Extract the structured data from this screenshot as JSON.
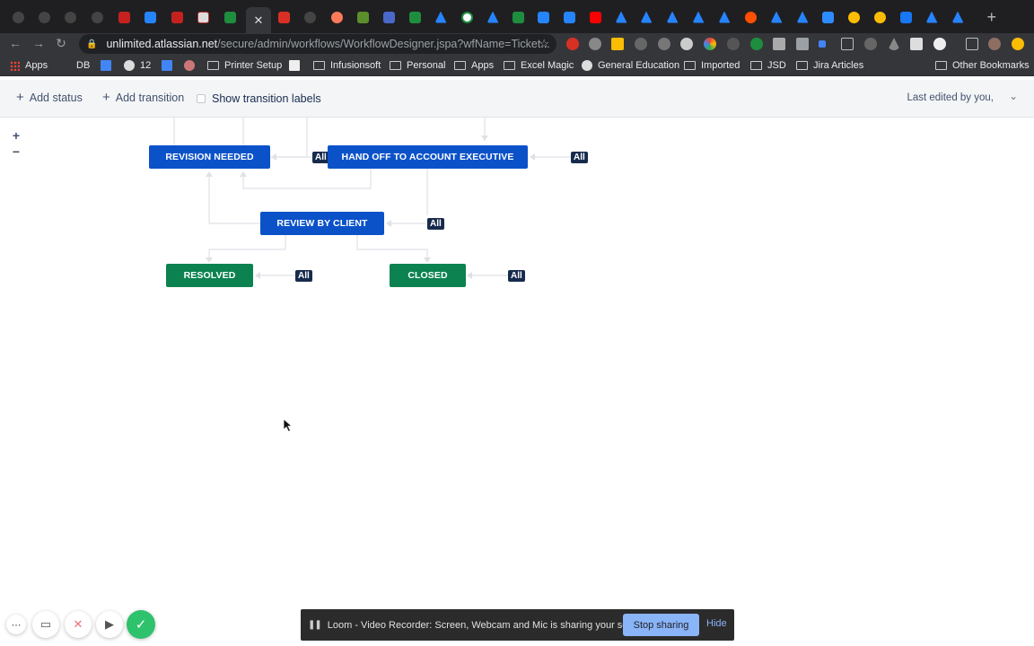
{
  "browser": {
    "url_host": "unlimited.atlassian.net",
    "url_path": "/secure/admin/workflows/WorkflowDesigner.jspa?wfName=Ticket...",
    "bookmarks": [
      {
        "label": "Apps",
        "icon": "apps-grid-icon"
      },
      {
        "label": "DB",
        "icon": "none"
      },
      {
        "label": "",
        "icon": "chart-icon"
      },
      {
        "label": "12",
        "icon": "globe-icon"
      },
      {
        "label": "",
        "icon": "bar-chart-icon"
      },
      {
        "label": "",
        "icon": "app-icon"
      },
      {
        "label": "Printer Setup",
        "icon": "folder-icon"
      },
      {
        "label": "",
        "icon": "calendar-icon"
      },
      {
        "label": "Infusionsoft",
        "icon": "folder-icon"
      },
      {
        "label": "Personal",
        "icon": "folder-icon"
      },
      {
        "label": "Apps",
        "icon": "folder-icon"
      },
      {
        "label": "Excel Magic",
        "icon": "folder-icon"
      },
      {
        "label": "General Education",
        "icon": "globe-icon"
      },
      {
        "label": "Imported",
        "icon": "folder-icon"
      },
      {
        "label": "JSD",
        "icon": "folder-icon"
      },
      {
        "label": "Jira Articles",
        "icon": "folder-icon"
      },
      {
        "label": "Other Bookmarks",
        "icon": "folder-icon"
      }
    ]
  },
  "toolbar": {
    "add_status": "Add status",
    "add_transition": "Add transition",
    "show_labels": "Show transition labels",
    "last_edited": "Last edited by you,"
  },
  "zoom": {
    "in": "+",
    "out": "−"
  },
  "workflow": {
    "statuses": {
      "revision_needed": "REVISION NEEDED",
      "hand_off": "HAND OFF TO ACCOUNT EXECUTIVE",
      "review_by_client": "REVIEW BY CLIENT",
      "resolved": "RESOLVED",
      "closed": "CLOSED"
    },
    "all_label": "All",
    "colors": {
      "in_progress": "#0b52c9",
      "done": "#0c8250",
      "all_badge": "#172b4d"
    }
  },
  "loom": {
    "message": "Loom - Video Recorder: Screen, Webcam and Mic is sharing your screen.",
    "stop": "Stop sharing",
    "hide": "Hide"
  }
}
